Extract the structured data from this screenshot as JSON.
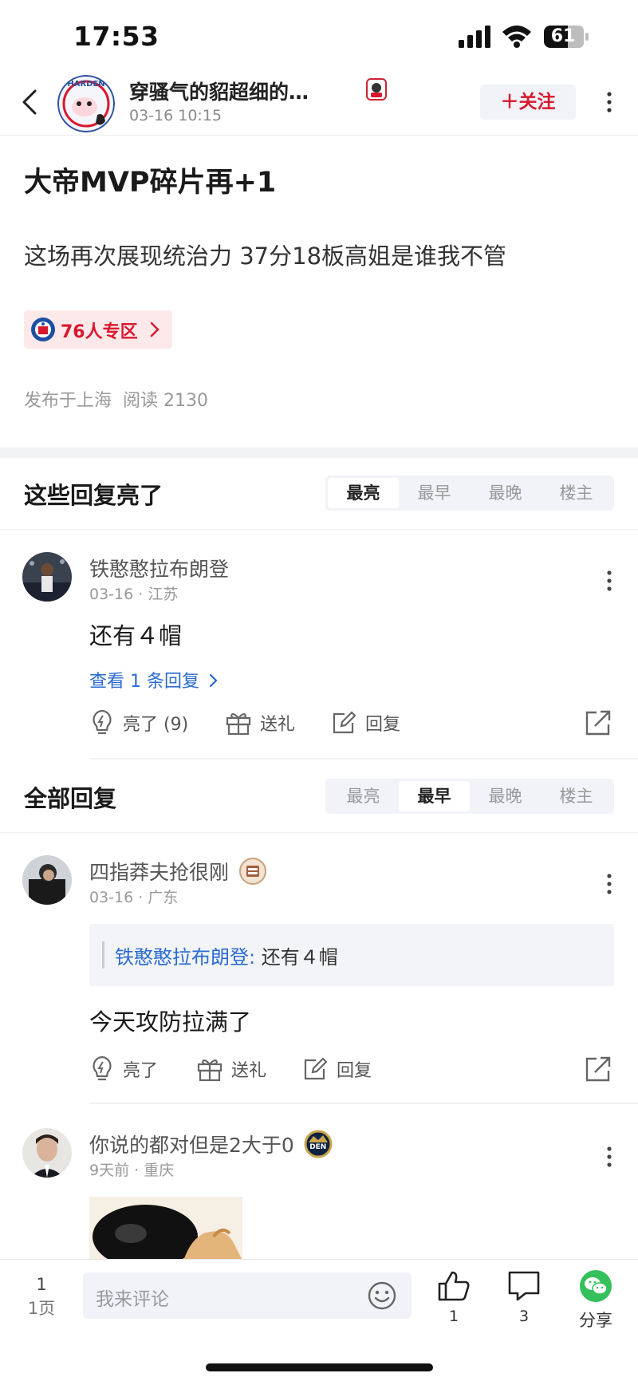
{
  "status_bar": {
    "time": "17:53",
    "battery": "61"
  },
  "header": {
    "author_name": "穿骚气的貂超细的…",
    "post_time": "03-16 10:15",
    "avatar_text": "HARDEN",
    "follow_label": "＋关注"
  },
  "post": {
    "title": "大帝MVP碎片再+1",
    "body": "这场再次展现统治力 37分18板高姐是谁我不管",
    "zone_tag": "76人专区",
    "meta": "发布于上海  阅读 2130"
  },
  "highlight_section": {
    "title": "这些回复亮了",
    "sort_tabs": [
      "最亮",
      "最早",
      "最晚",
      "楼主"
    ],
    "active_tab": "最亮",
    "replies": [
      {
        "name": "铁憨憨拉布朗登",
        "meta": "03-16 · 江苏",
        "content": "还有４帽",
        "view_replies": "查看 1 条回复",
        "like_label": "亮了 (9)",
        "gift_label": "送礼",
        "reply_label": "回复"
      }
    ]
  },
  "all_section": {
    "title": "全部回复",
    "sort_tabs": [
      "最亮",
      "最早",
      "最晚",
      "楼主"
    ],
    "active_tab": "最早",
    "replies": [
      {
        "name": "四指莽夫抢很刚",
        "meta": "03-16 · 广东",
        "quote_author": "铁憨憨拉布朗登:",
        "quote_text": " 还有４帽",
        "content": "今天攻防拉满了",
        "like_label": "亮了",
        "gift_label": "送礼",
        "reply_label": "回复"
      },
      {
        "name": "你说的都对但是2大于0",
        "badge_text": "DEN",
        "meta": "9天前 · 重庆"
      }
    ]
  },
  "bottom_bar": {
    "page_current": "1",
    "page_label": "1页",
    "comment_placeholder": "我来评论",
    "like_count": "1",
    "comment_count": "3",
    "share_label": "分享"
  },
  "colors": {
    "accent_red": "#d8182f",
    "link_blue": "#2b6bd1",
    "wechat_green": "#34c05a"
  }
}
